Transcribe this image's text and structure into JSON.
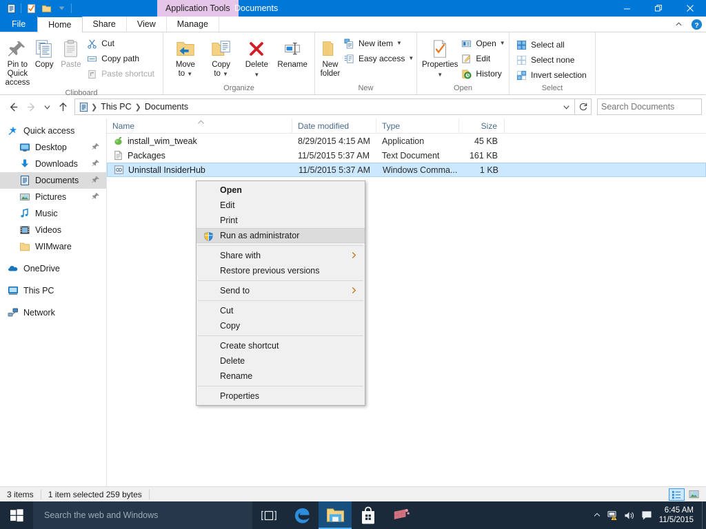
{
  "window": {
    "app_tools_tab": "Application Tools",
    "document_title": "Documents",
    "quick_access_icons": [
      "documents-icon",
      "checkmark-icon",
      "folder-icon"
    ],
    "controls": {
      "minimize": "minimize-button",
      "restore": "restore-button",
      "close": "close-button"
    }
  },
  "ribbon": {
    "tabs": [
      {
        "label": "File",
        "key": "file"
      },
      {
        "label": "Home",
        "key": "home",
        "active": true
      },
      {
        "label": "Share",
        "key": "share"
      },
      {
        "label": "View",
        "key": "view"
      },
      {
        "label": "Manage",
        "key": "manage"
      }
    ],
    "groups": [
      {
        "label": "Clipboard",
        "big": [
          {
            "label_line1": "Pin to Quick",
            "label_line2": "access",
            "icon": "pin-icon",
            "disabled": false
          },
          {
            "label_line1": "Copy",
            "label_line2": "",
            "icon": "copy-icon",
            "disabled": false
          },
          {
            "label_line1": "Paste",
            "label_line2": "",
            "icon": "paste-icon",
            "disabled": true
          }
        ],
        "small": [
          {
            "label": "Cut",
            "icon": "scissors-icon",
            "disabled": false
          },
          {
            "label": "Copy path",
            "icon": "copy-path-icon",
            "disabled": false
          },
          {
            "label": "Paste shortcut",
            "icon": "paste-shortcut-icon",
            "disabled": true
          }
        ]
      },
      {
        "label": "Organize",
        "big": [
          {
            "label_line1": "Move",
            "label_line2": "to",
            "icon": "move-to-icon",
            "dropdown": true
          },
          {
            "label_line1": "Copy",
            "label_line2": "to",
            "icon": "copy-to-icon",
            "dropdown": true
          },
          {
            "label_line1": "Delete",
            "label_line2": "",
            "icon": "delete-x-icon",
            "dropdown": true
          },
          {
            "label_line1": "Rename",
            "label_line2": "",
            "icon": "rename-icon"
          }
        ]
      },
      {
        "label": "New",
        "big": [
          {
            "label_line1": "New",
            "label_line2": "folder",
            "icon": "new-folder-icon"
          }
        ],
        "small": [
          {
            "label": "New item",
            "icon": "new-item-icon",
            "dropdown": true
          },
          {
            "label": "Easy access",
            "icon": "easy-access-icon",
            "dropdown": true
          }
        ]
      },
      {
        "label": "Open",
        "big": [
          {
            "label_line1": "Properties",
            "label_line2": "",
            "icon": "properties-icon",
            "dropdown": true
          }
        ],
        "small": [
          {
            "label": "Open",
            "icon": "open-icon",
            "dropdown": true
          },
          {
            "label": "Edit",
            "icon": "edit-pencil-icon"
          },
          {
            "label": "History",
            "icon": "history-icon"
          }
        ]
      },
      {
        "label": "Select",
        "small": [
          {
            "label": "Select all",
            "icon": "select-all-icon"
          },
          {
            "label": "Select none",
            "icon": "select-none-icon"
          },
          {
            "label": "Invert selection",
            "icon": "invert-selection-icon"
          }
        ]
      }
    ]
  },
  "address": {
    "back": "back-arrow-icon",
    "forward": "forward-arrow-icon",
    "recent": "recent-locations-icon",
    "up": "up-arrow-icon",
    "breadcrumbs": [
      "This PC",
      "Documents"
    ],
    "refresh": "refresh-icon",
    "search_placeholder": "Search Documents",
    "search_value": ""
  },
  "navpane": {
    "items": [
      {
        "label": "Quick access",
        "icon": "quick-access-star-icon",
        "indent": false,
        "pinned": false,
        "selected": false
      },
      {
        "label": "Desktop",
        "icon": "desktop-icon",
        "indent": true,
        "pinned": true,
        "selected": false
      },
      {
        "label": "Downloads",
        "icon": "downloads-icon",
        "indent": true,
        "pinned": true,
        "selected": false
      },
      {
        "label": "Documents",
        "icon": "documents-icon",
        "indent": true,
        "pinned": true,
        "selected": true
      },
      {
        "label": "Pictures",
        "icon": "pictures-icon",
        "indent": true,
        "pinned": true,
        "selected": false
      },
      {
        "label": "Music",
        "icon": "music-note-icon",
        "indent": true,
        "pinned": false,
        "selected": false
      },
      {
        "label": "Videos",
        "icon": "videos-icon",
        "indent": true,
        "pinned": false,
        "selected": false
      },
      {
        "label": "WIMware",
        "icon": "folder-icon",
        "indent": true,
        "pinned": false,
        "selected": false
      },
      {
        "label": "OneDrive",
        "icon": "onedrive-cloud-icon",
        "indent": false,
        "pinned": false,
        "selected": false,
        "gap_before": true
      },
      {
        "label": "This PC",
        "icon": "this-pc-icon",
        "indent": false,
        "pinned": false,
        "selected": false,
        "gap_before": true
      },
      {
        "label": "Network",
        "icon": "network-icon",
        "indent": false,
        "pinned": false,
        "selected": false,
        "gap_before": true
      }
    ]
  },
  "filelist": {
    "columns": [
      {
        "label": "Name",
        "key": "name"
      },
      {
        "label": "Date modified",
        "key": "date"
      },
      {
        "label": "Type",
        "key": "type"
      },
      {
        "label": "Size",
        "key": "size"
      }
    ],
    "sort_column": "Name",
    "sort_direction": "ascending",
    "rows": [
      {
        "name": "install_wim_tweak",
        "date": "8/29/2015 4:15 AM",
        "type": "Application",
        "size": "45 KB",
        "icon": "application-icon",
        "selected": false
      },
      {
        "name": "Packages",
        "date": "11/5/2015 5:37 AM",
        "type": "Text Document",
        "size": "161 KB",
        "icon": "text-document-icon",
        "selected": false
      },
      {
        "name": "Uninstall InsiderHub",
        "date": "11/5/2015 5:37 AM",
        "type": "Windows Comma...",
        "size": "1 KB",
        "icon": "batch-file-icon",
        "selected": true
      }
    ]
  },
  "context_menu": {
    "items": [
      {
        "label": "Open",
        "bold": true,
        "icon": null,
        "submenu": false,
        "highlighted": false
      },
      {
        "label": "Edit",
        "bold": false,
        "icon": null,
        "submenu": false,
        "highlighted": false
      },
      {
        "label": "Print",
        "bold": false,
        "icon": null,
        "submenu": false,
        "highlighted": false
      },
      {
        "label": "Run as administrator",
        "bold": false,
        "icon": "uac-shield-icon",
        "submenu": false,
        "highlighted": true
      },
      {
        "separator": true
      },
      {
        "label": "Share with",
        "bold": false,
        "icon": null,
        "submenu": true,
        "highlighted": false
      },
      {
        "label": "Restore previous versions",
        "bold": false,
        "icon": null,
        "submenu": false,
        "highlighted": false
      },
      {
        "separator": true
      },
      {
        "label": "Send to",
        "bold": false,
        "icon": null,
        "submenu": true,
        "highlighted": false
      },
      {
        "separator": true
      },
      {
        "label": "Cut",
        "bold": false,
        "icon": null,
        "submenu": false,
        "highlighted": false
      },
      {
        "label": "Copy",
        "bold": false,
        "icon": null,
        "submenu": false,
        "highlighted": false
      },
      {
        "separator": true
      },
      {
        "label": "Create shortcut",
        "bold": false,
        "icon": null,
        "submenu": false,
        "highlighted": false
      },
      {
        "label": "Delete",
        "bold": false,
        "icon": null,
        "submenu": false,
        "highlighted": false
      },
      {
        "label": "Rename",
        "bold": false,
        "icon": null,
        "submenu": false,
        "highlighted": false
      },
      {
        "separator": true
      },
      {
        "label": "Properties",
        "bold": false,
        "icon": null,
        "submenu": false,
        "highlighted": false
      }
    ]
  },
  "statusbar": {
    "item_count": "3 items",
    "selection_info": "1 item selected  259 bytes",
    "views": [
      {
        "name": "details-view-button",
        "active": true
      },
      {
        "name": "large-icons-view-button",
        "active": false
      }
    ]
  },
  "taskbar": {
    "start": "start-button",
    "search_placeholder": "Search the web and Windows",
    "buttons": [
      {
        "name": "task-view-button",
        "icon": "task-view-icon",
        "running": false
      },
      {
        "name": "edge-button",
        "icon": "edge-icon",
        "running": false
      },
      {
        "name": "file-explorer-button",
        "icon": "file-explorer-icon",
        "running": true
      },
      {
        "name": "store-button",
        "icon": "store-bag-icon",
        "running": false
      },
      {
        "name": "app-button",
        "icon": "pink-cube-icon",
        "running": false
      }
    ],
    "tray": [
      {
        "name": "show-hidden-icons-button",
        "icon": "chevron-up-icon"
      },
      {
        "name": "network-button",
        "icon": "network-warning-icon"
      },
      {
        "name": "volume-button",
        "icon": "speaker-icon"
      },
      {
        "name": "action-center-button",
        "icon": "notification-icon"
      }
    ],
    "clock_time": "6:45 AM",
    "clock_date": "11/5/2015"
  },
  "colors": {
    "accent": "#0078d7",
    "selection": "#cce8ff",
    "app_tools_tab": "#e5c5e8",
    "taskbar": "#1b2a3a"
  }
}
